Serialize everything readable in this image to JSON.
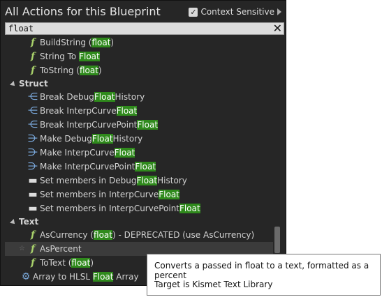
{
  "window": {
    "title": "All Actions for this Blueprint",
    "context_sensitive_label": "Context Sensitive",
    "context_sensitive_checked": true
  },
  "search": {
    "value": "float",
    "clear_icon": "close-icon"
  },
  "items": [
    {
      "type": "func",
      "pre": "BuildString (",
      "hl": "float",
      "post": ")"
    },
    {
      "type": "func",
      "pre": "String To ",
      "hl": "Float",
      "post": ""
    },
    {
      "type": "func",
      "pre": "ToString (",
      "hl": "float",
      "post": ")"
    },
    {
      "type": "category",
      "label": "Struct"
    },
    {
      "type": "break",
      "pre": "Break Debug",
      "hl": "Float",
      "post": "History"
    },
    {
      "type": "break",
      "pre": "Break InterpCurve",
      "hl": "Float",
      "post": ""
    },
    {
      "type": "break",
      "pre": "Break InterpCurvePoint",
      "hl": "Float",
      "post": ""
    },
    {
      "type": "make",
      "pre": "Make Debug",
      "hl": "Float",
      "post": "History"
    },
    {
      "type": "make",
      "pre": "Make InterpCurve",
      "hl": "Float",
      "post": ""
    },
    {
      "type": "make",
      "pre": "Make InterpCurvePoint",
      "hl": "Float",
      "post": ""
    },
    {
      "type": "set",
      "pre": "Set members in Debug",
      "hl": "Float",
      "post": "History"
    },
    {
      "type": "set",
      "pre": "Set members in InterpCurve",
      "hl": "Float",
      "post": ""
    },
    {
      "type": "set",
      "pre": "Set members in InterpCurvePoint",
      "hl": "Float",
      "post": ""
    },
    {
      "type": "category",
      "label": "Text"
    },
    {
      "type": "func",
      "pre": "AsCurrency (",
      "hl": "float",
      "post": ") - DEPRECATED (use AsCurrency)"
    },
    {
      "type": "func",
      "pre": "AsPercent",
      "hl": "",
      "post": "",
      "hover": true
    },
    {
      "type": "func",
      "pre": "ToText (",
      "hl": "float",
      "post": ")"
    },
    {
      "type": "gear",
      "pre": "Array to HLSL ",
      "hl": "Float",
      "post": " Array"
    }
  ],
  "tooltip": {
    "description": "Converts a passed in float to a text, formatted as a percent",
    "target": "Target is Kismet Text Library"
  },
  "colors": {
    "highlight": "#2f8a1c",
    "panel_bg": "#262626",
    "function_icon": "#a9d26b",
    "struct_icon": "#7fb0e6"
  }
}
